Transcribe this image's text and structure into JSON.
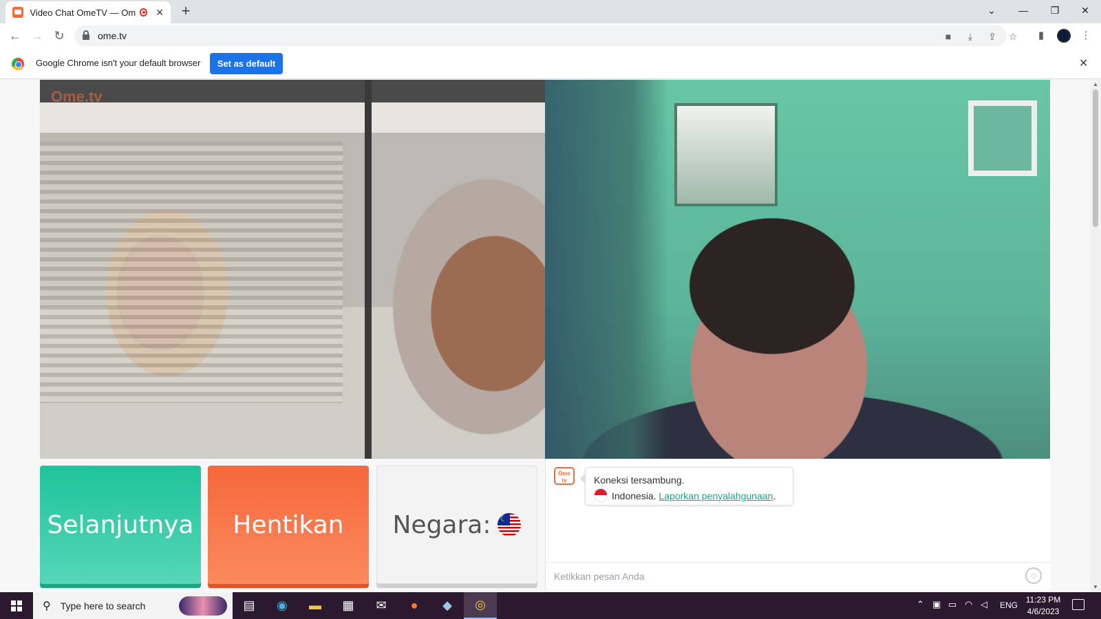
{
  "browser": {
    "tab_title": "Video Chat OmeTV — Omegle",
    "new_tab_symbol": "+",
    "url": "ome.tv"
  },
  "infobar": {
    "message": "Google Chrome isn't your default browser",
    "set_default_label": "Set as default"
  },
  "app": {
    "logo_text": "Ome.tv",
    "next_button": "Selanjutnya",
    "stop_button": "Hentikan",
    "country_label": "Negara:",
    "country_flag": "malaysia-flag",
    "accent_green": "#1fc49a",
    "accent_orange": "#f6673d"
  },
  "chat": {
    "avatar_text": "Ome tv",
    "status": "Koneksi tersambung.",
    "country": "Indonesia.",
    "report_link": "Laporkan penyalahgunaan",
    "after_link": ".",
    "input_placeholder": "Ketikkan pesan Anda"
  },
  "taskbar": {
    "search_placeholder": "Type here to search",
    "language": "ENG",
    "time": "11:23 PM",
    "date": "4/6/2023"
  }
}
